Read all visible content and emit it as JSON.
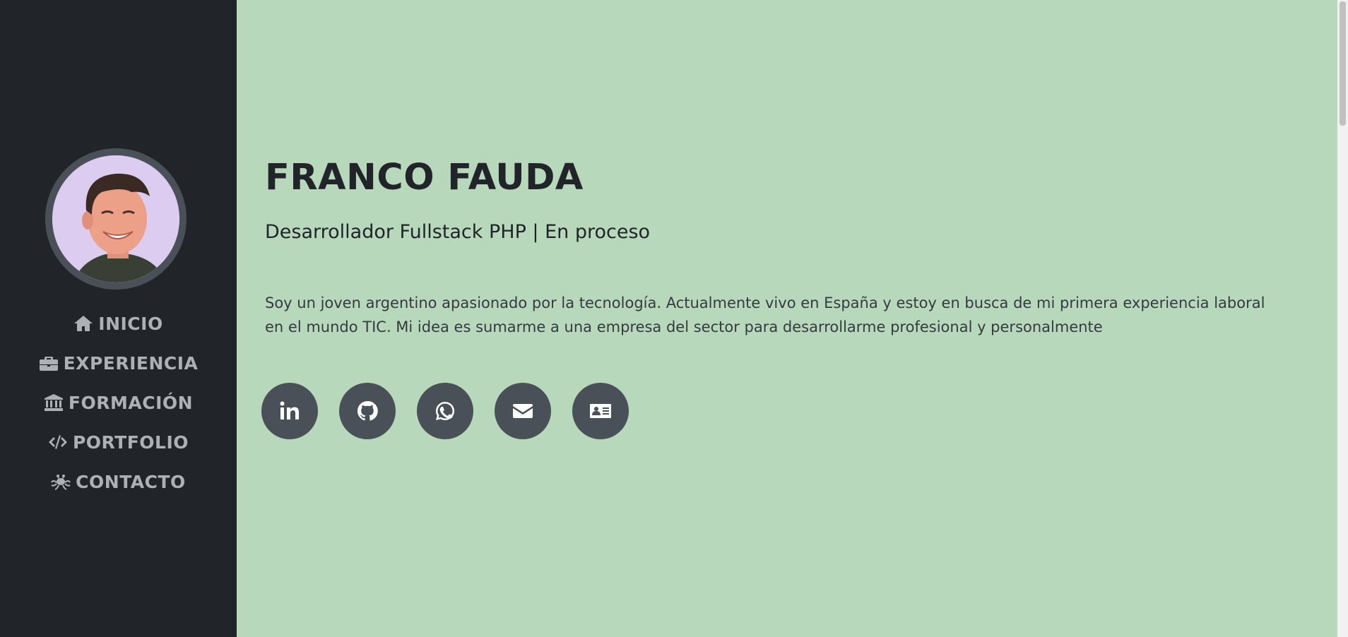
{
  "sidebar": {
    "avatar_alt": "Franco Fauda",
    "nav": [
      {
        "label": "INICIO",
        "icon": "home-icon"
      },
      {
        "label": "EXPERIENCIA",
        "icon": "briefcase-icon"
      },
      {
        "label": "FORMACIÓN",
        "icon": "university-icon"
      },
      {
        "label": "PORTFOLIO",
        "icon": "code-icon"
      },
      {
        "label": "CONTACTO",
        "icon": "spaghetti-monster-icon"
      }
    ]
  },
  "main": {
    "name": "FRANCO FAUDA",
    "role": "Desarrollador Fullstack PHP | En proceso",
    "bio": "Soy un joven argentino apasionado por la tecnología. Actualmente vivo en España y estoy en busca de mi primera experiencia laboral en el mundo TIC. Mi idea es sumarme a una empresa del sector para desarrollarme profesional y personalmente",
    "social": [
      {
        "icon": "linkedin-icon"
      },
      {
        "icon": "github-icon"
      },
      {
        "icon": "whatsapp-icon"
      },
      {
        "icon": "envelope-icon"
      },
      {
        "icon": "id-card-icon"
      }
    ]
  },
  "colors": {
    "sidebar_bg": "#212529",
    "main_bg": "#b8d8bc",
    "nav_text": "#adb1b6",
    "social_bg": "#495057"
  }
}
